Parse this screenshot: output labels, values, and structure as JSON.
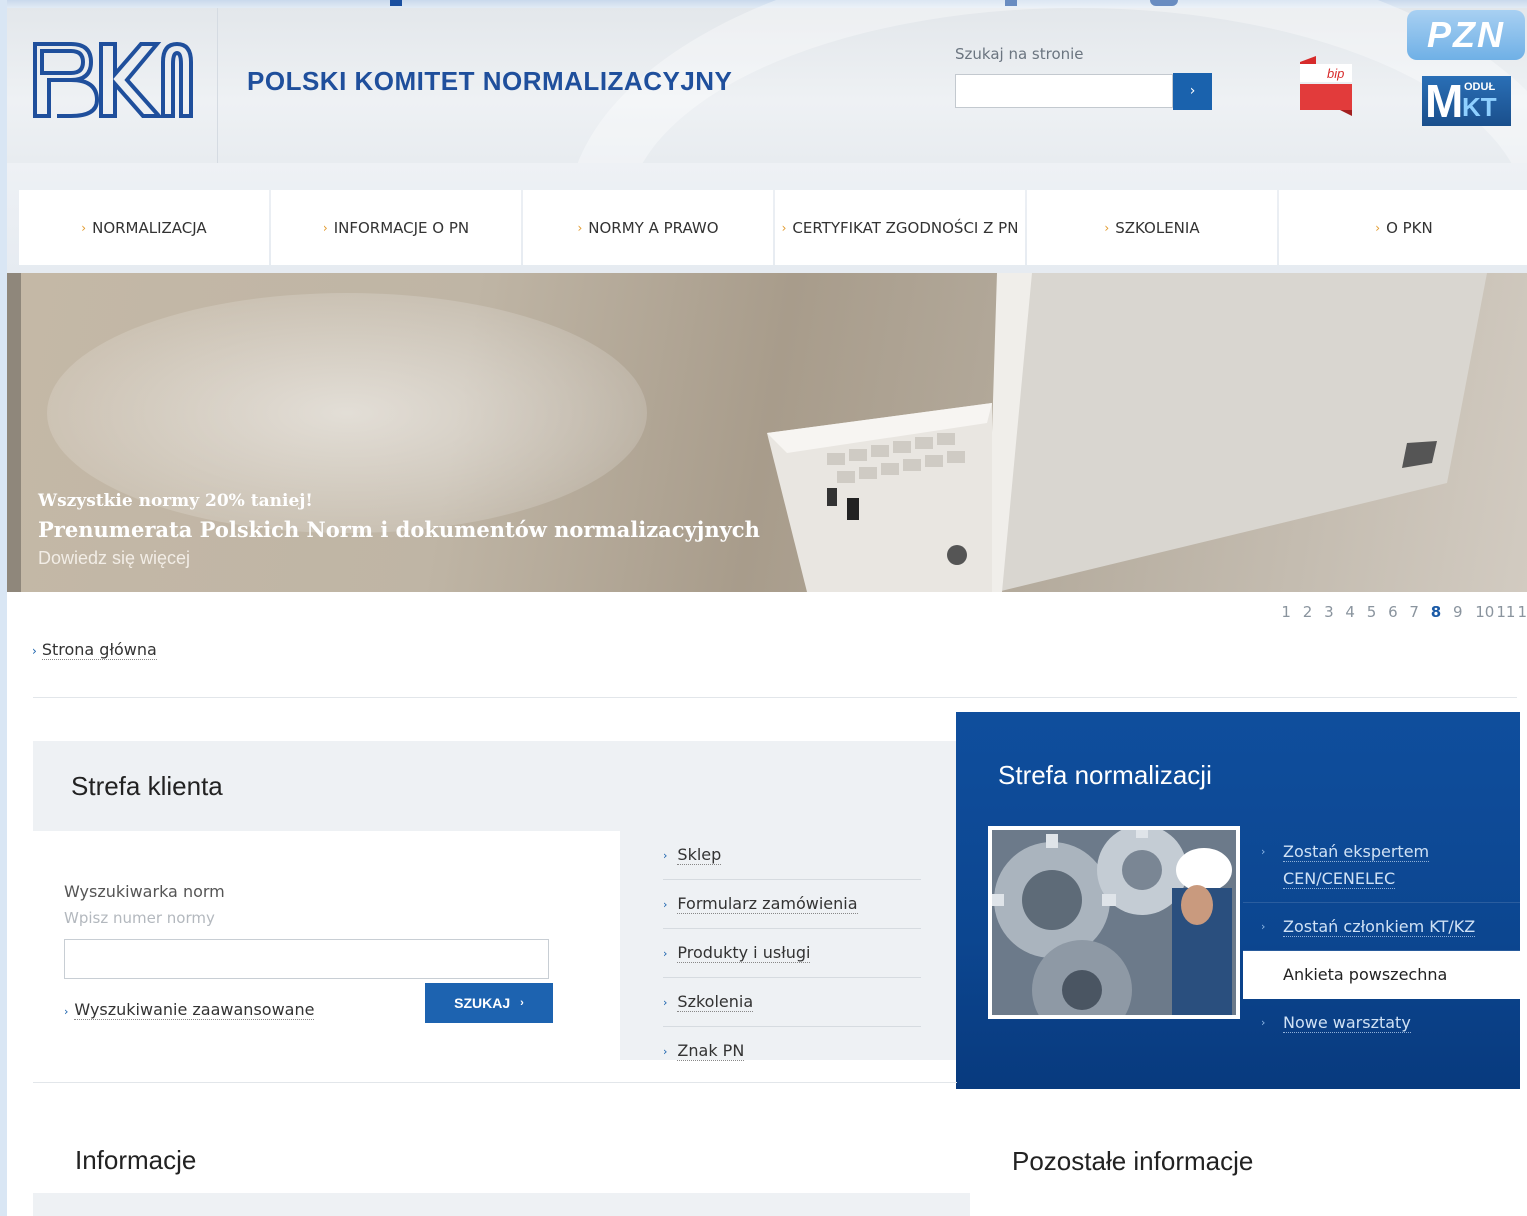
{
  "header": {
    "org_name": "POLSKI KOMITET NORMALIZACYJNY",
    "search_label": "Szukaj na stronie",
    "search_button": "›",
    "bip_label": "bip",
    "pzn_label": "PZN",
    "mkt_label": {
      "m": "M",
      "small": "ODUŁ",
      "kt": "KT"
    }
  },
  "nav": [
    {
      "label": "NORMALIZACJA"
    },
    {
      "label": "INFORMACJE O PN"
    },
    {
      "label": "NORMY A PRAWO"
    },
    {
      "label": "CERTYFIKAT ZGODNOŚCI Z PN"
    },
    {
      "label": "SZKOLENIA"
    },
    {
      "label": "O PKN"
    }
  ],
  "banner": {
    "line1": "Wszystkie normy 20% taniej!",
    "line2": "Prenumerata Polskich Norm i dokumentów normalizacyjnych",
    "line3": "Dowiedz się więcej"
  },
  "pager": {
    "pages": [
      "1",
      "2",
      "3",
      "4",
      "5",
      "6",
      "7",
      "8",
      "9",
      "10",
      "11",
      "1"
    ],
    "active": "8"
  },
  "breadcrumb": {
    "home": "Strona główna"
  },
  "strefa_klienta": {
    "title": "Strefa klienta",
    "search_label": "Wyszukiwarka norm",
    "search_hint": "Wpisz numer normy",
    "advanced": "Wyszukiwanie zaawansowane",
    "button": "SZUKAJ",
    "links": [
      "Sklep",
      "Formularz zamówienia",
      "Produkty i usługi",
      "Szkolenia",
      "Znak PN"
    ]
  },
  "strefa_normalizacji": {
    "title": "Strefa normalizacji",
    "items": [
      {
        "label": "Zostań ekspertem CEN/CENELEC",
        "active": false
      },
      {
        "label": "Zostań członkiem KT/KZ",
        "active": false
      },
      {
        "label": "Ankieta powszechna",
        "active": true
      },
      {
        "label": "Nowe warsztaty",
        "active": false
      }
    ]
  },
  "sections": {
    "informacje": "Informacje",
    "pozostale": "Pozostałe informacje"
  },
  "colors": {
    "brand_blue": "#1a62ad",
    "nav_arrow": "#e29b2e",
    "panel_blue": "#0f4e9d"
  }
}
